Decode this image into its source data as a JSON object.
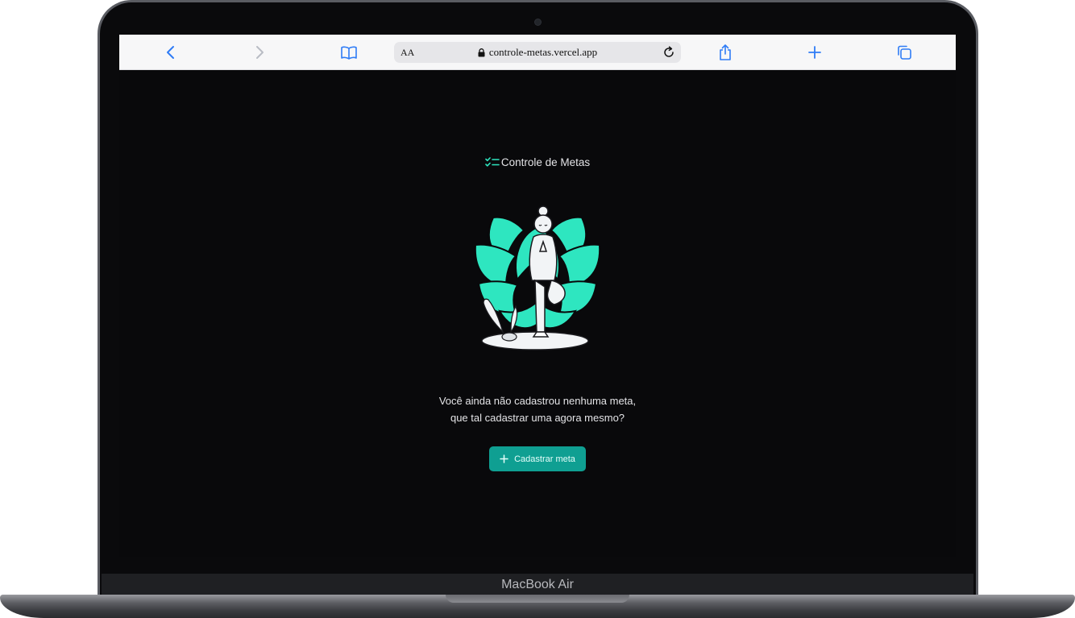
{
  "device": {
    "model_label": "MacBook Air"
  },
  "browser": {
    "text_size_label": "AA",
    "url": "controle-metas.vercel.app",
    "accent_color": "#2f7cf6",
    "icons": [
      "back-icon",
      "forward-icon",
      "bookmarks-icon",
      "lock-icon",
      "reload-icon",
      "share-icon",
      "new-tab-icon",
      "tabs-icon"
    ]
  },
  "app": {
    "brand": "Controle de Metas",
    "empty_state": {
      "line1": "Você ainda não cadastrou nenhuma meta,",
      "line2": "que tal cadastrar uma agora mesmo?"
    },
    "cta_label": "Cadastrar meta",
    "accent_color": "#2ee6c0",
    "button_color": "#0f9f92",
    "background_color": "#09090b"
  }
}
